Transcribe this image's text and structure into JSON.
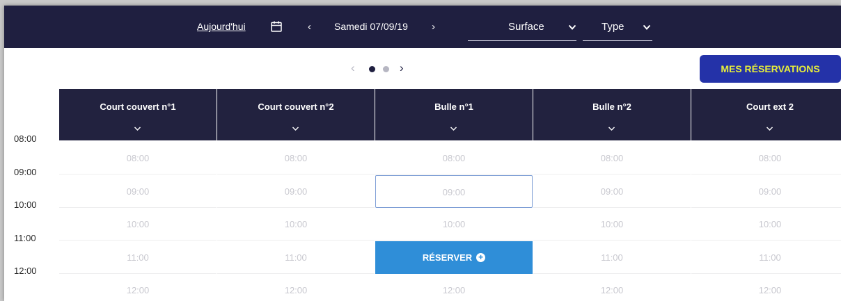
{
  "header": {
    "today_label": "Aujourd'hui",
    "calendar_icon": "calendar-icon",
    "prev_icon": "‹",
    "date": "Samedi 07/09/19",
    "next_icon": "›",
    "surface_filter": "Surface",
    "type_filter": "Type"
  },
  "pager": {
    "prev": "‹",
    "next": "›",
    "pages": 2,
    "current": 1
  },
  "my_reservations_label": "MES RÉSERVATIONS",
  "colors": {
    "navy": "#1f1f40",
    "button_blue": "#2432a8",
    "button_text": "#e7ee3a",
    "reserve_blue": "#2f8ed8"
  },
  "time_axis": [
    "08:00",
    "09:00",
    "10:00",
    "11:00",
    "12:00"
  ],
  "courts": [
    {
      "name": "Court couvert n°1",
      "slots": [
        "08:00",
        "09:00",
        "10:00",
        "11:00",
        "12:00"
      ]
    },
    {
      "name": "Court couvert n°2",
      "slots": [
        "08:00",
        "09:00",
        "10:00",
        "11:00",
        "12:00"
      ]
    },
    {
      "name": "Bulle n°1",
      "slots": [
        "08:00",
        "09:00",
        "10:00",
        "RÉSERVER",
        "12:00"
      ]
    },
    {
      "name": "Bulle n°2",
      "slots": [
        "08:00",
        "09:00",
        "10:00",
        "11:00",
        "12:00"
      ]
    },
    {
      "name": "Court ext 2",
      "slots": [
        "08:00",
        "09:00",
        "10:00",
        "11:00",
        "12:00"
      ]
    }
  ],
  "reserve_label": "RÉSERVER",
  "selected_slot": {
    "court": "Bulle n°1",
    "time": "09:00"
  }
}
